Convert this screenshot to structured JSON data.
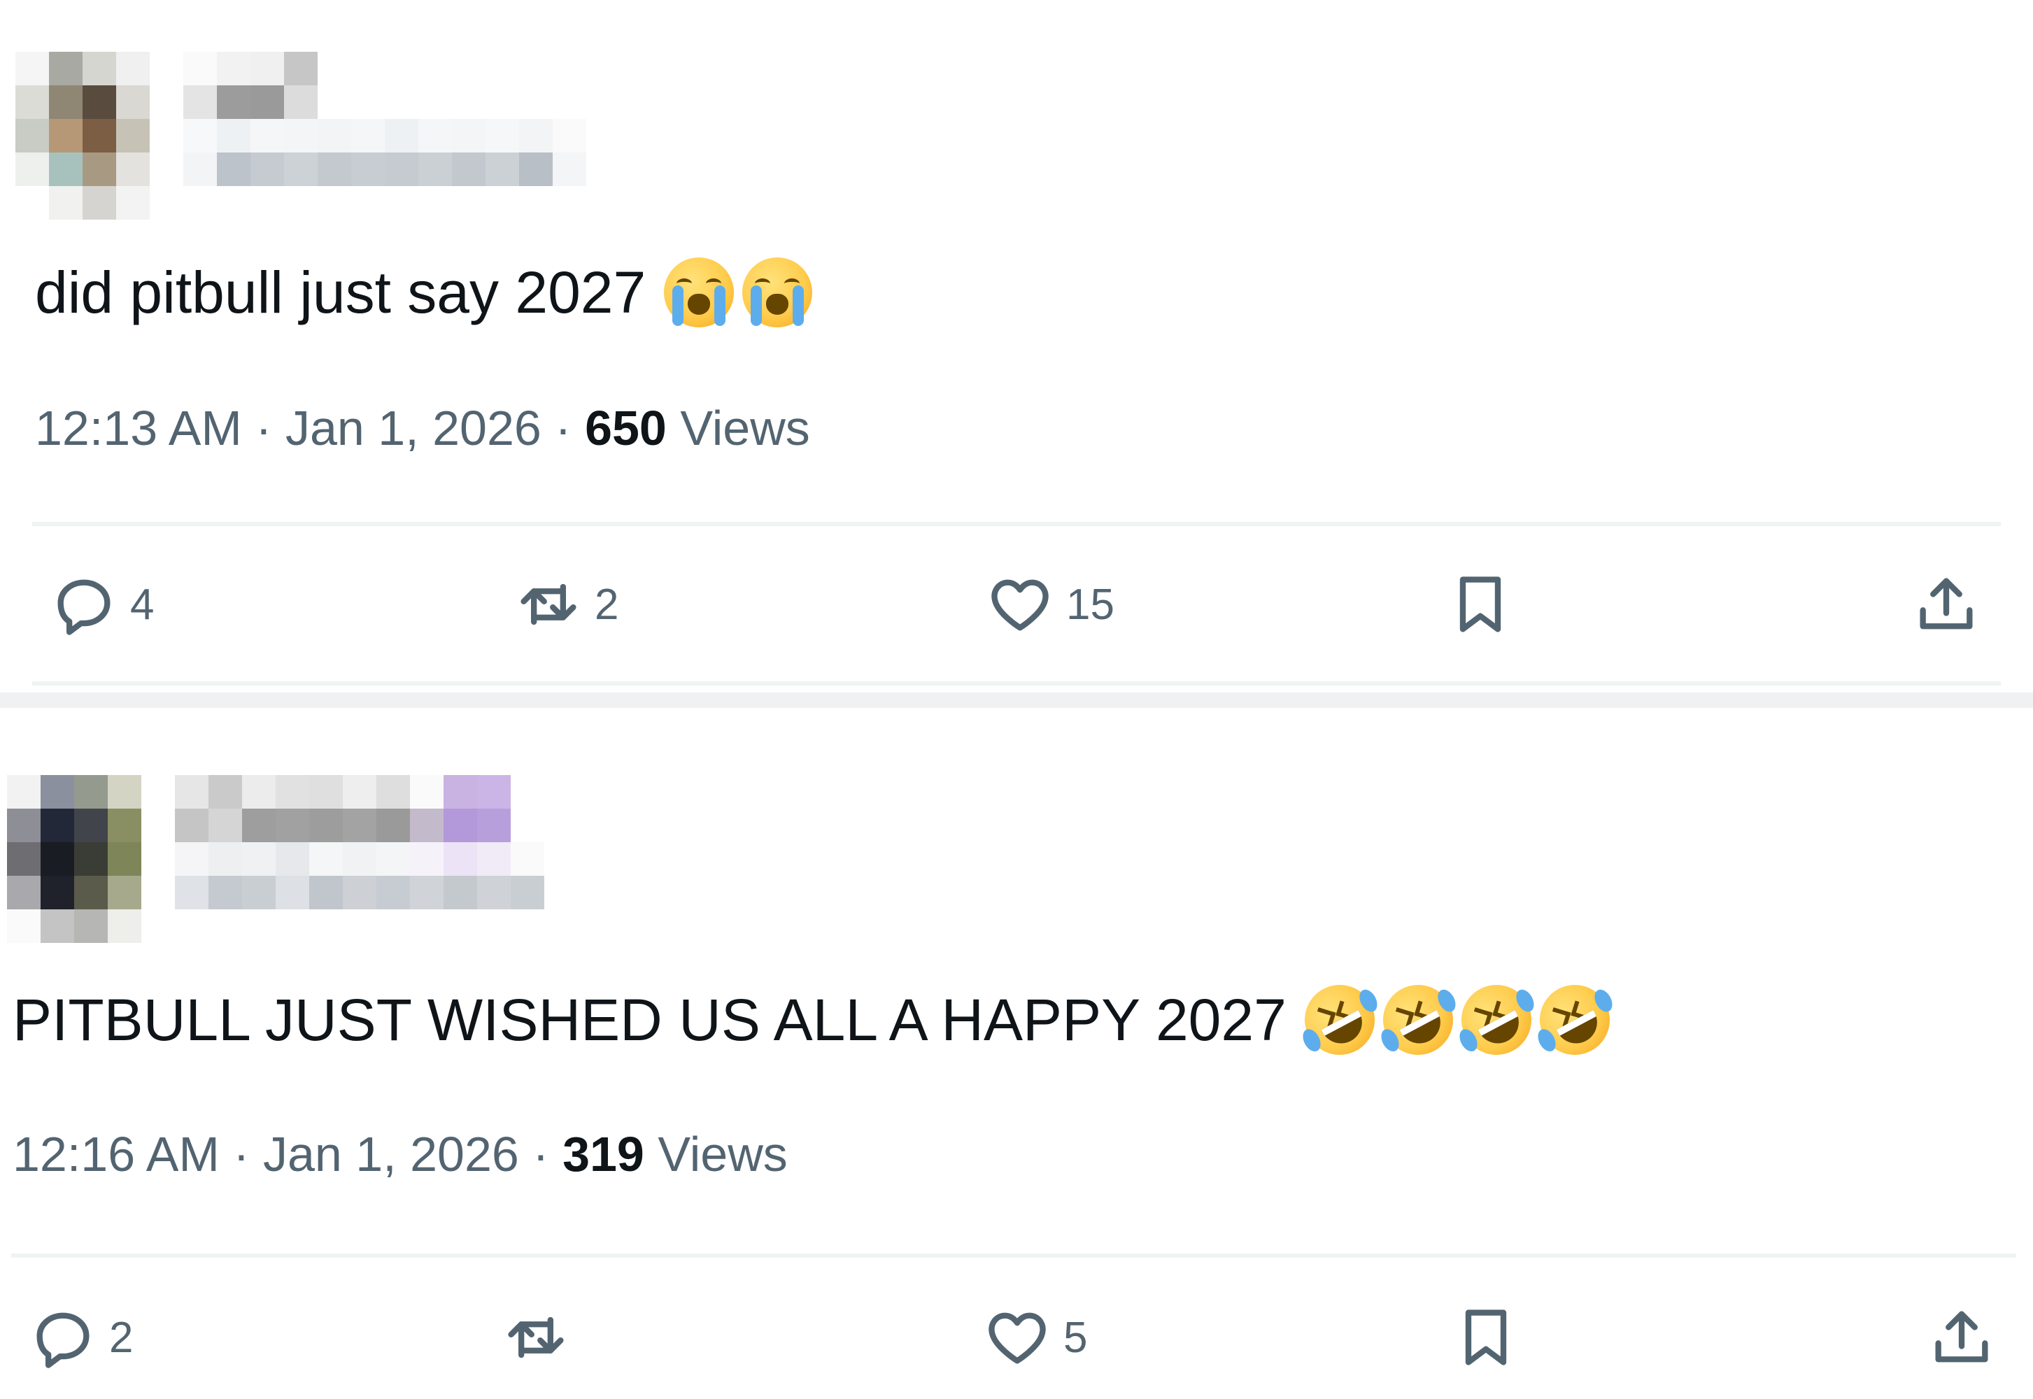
{
  "tweets": [
    {
      "text": "did pitbull just say 2027",
      "emoji": [
        "loudly-crying-face",
        "loudly-crying-face"
      ],
      "time": "12:13 AM",
      "date": "Jan 1, 2026",
      "separator": "·",
      "views_count": "650",
      "views_label": "Views",
      "actions": {
        "replies": "4",
        "reposts": "2",
        "likes": "15"
      }
    },
    {
      "text": "PITBULL JUST WISHED US ALL A HAPPY 2027",
      "emoji": [
        "rolling-on-floor-laughing",
        "rolling-on-floor-laughing",
        "rolling-on-floor-laughing",
        "rolling-on-floor-laughing"
      ],
      "time": "12:16 AM",
      "date": "Jan 1, 2026",
      "separator": "·",
      "views_count": "319",
      "views_label": "Views",
      "actions": {
        "replies": "2",
        "reposts": "",
        "likes": "5"
      }
    }
  ],
  "colors": {
    "text": "#0f1419",
    "secondary": "#536471",
    "divider": "#eff3f4",
    "background": "#ffffff"
  },
  "icons": [
    "reply-icon",
    "repost-icon",
    "like-icon",
    "bookmark-icon",
    "share-icon"
  ]
}
